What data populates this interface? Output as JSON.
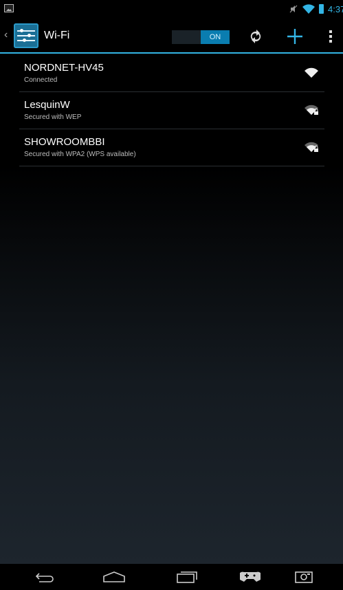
{
  "status_bar": {
    "time": "4:37",
    "icons": [
      "image-icon",
      "mute-icon",
      "wifi-icon",
      "battery-icon"
    ]
  },
  "action_bar": {
    "title": "Wi-Fi",
    "toggle_label": "ON",
    "icons": [
      "back-chevron-icon",
      "settings-icon",
      "wps-refresh-icon",
      "add-icon",
      "overflow-menu-icon"
    ],
    "accent_color": "#33b5e5"
  },
  "networks": [
    {
      "name": "NORDNET-HV45",
      "status": "Connected",
      "locked": false
    },
    {
      "name": "LesquinW",
      "status": "Secured with WEP",
      "locked": true
    },
    {
      "name": "SHOWROOMBBI",
      "status": "Secured with WPA2 (WPS available)",
      "locked": true
    }
  ],
  "nav_bar": {
    "icons": [
      "back-icon",
      "home-icon",
      "recents-icon",
      "gamepad-icon",
      "screenshot-icon"
    ]
  }
}
